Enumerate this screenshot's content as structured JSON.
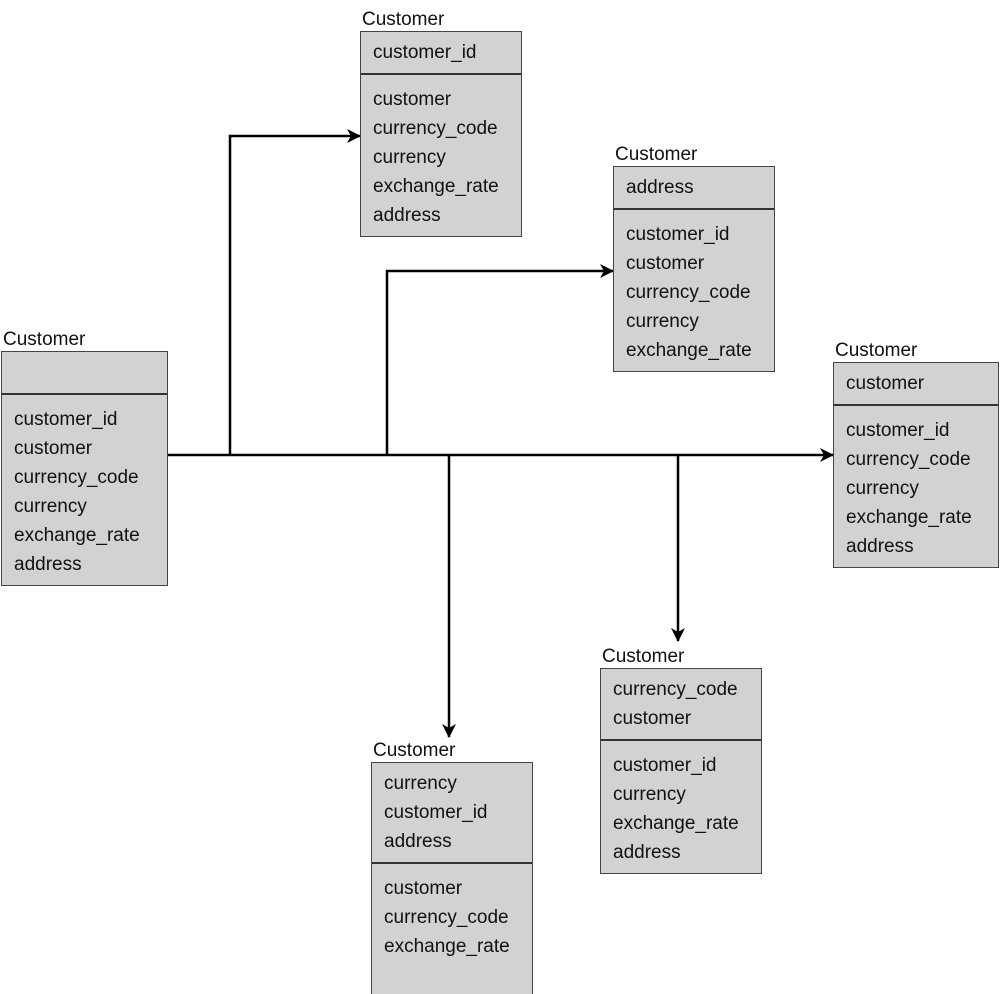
{
  "diagram": {
    "type": "entity-decomposition",
    "source_entity": "e0",
    "entities": [
      {
        "id": "e0",
        "title": "Customer",
        "key": [],
        "attributes": [
          "customer_id",
          "customer",
          "currency_code",
          "currency",
          "exchange_rate",
          "address"
        ]
      },
      {
        "id": "e1",
        "title": "Customer",
        "key": [
          "customer_id"
        ],
        "attributes": [
          "customer",
          "currency_code",
          "currency",
          "exchange_rate",
          "address"
        ]
      },
      {
        "id": "e2",
        "title": "Customer",
        "key": [
          "address"
        ],
        "attributes": [
          "customer_id",
          "customer",
          "currency_code",
          "currency",
          "exchange_rate"
        ]
      },
      {
        "id": "e3",
        "title": "Customer",
        "key": [
          "customer"
        ],
        "attributes": [
          "customer_id",
          "currency_code",
          "currency",
          "exchange_rate",
          "address"
        ]
      },
      {
        "id": "e4",
        "title": "Customer",
        "key": [
          "currency_code",
          "customer"
        ],
        "attributes": [
          "customer_id",
          "currency",
          "exchange_rate",
          "address"
        ]
      },
      {
        "id": "e5",
        "title": "Customer",
        "key": [
          "currency",
          "customer_id",
          "address"
        ],
        "attributes": [
          "customer",
          "currency_code",
          "exchange_rate"
        ]
      }
    ],
    "edges": [
      {
        "from": "e0",
        "to": "e1",
        "arrow": "end"
      },
      {
        "from": "e0",
        "to": "e2",
        "arrow": "end"
      },
      {
        "from": "e0",
        "to": "e3",
        "arrow": "end"
      },
      {
        "from": "e0",
        "to": "e4",
        "arrow": "end"
      },
      {
        "from": "e0",
        "to": "e5",
        "arrow": "end"
      }
    ]
  }
}
